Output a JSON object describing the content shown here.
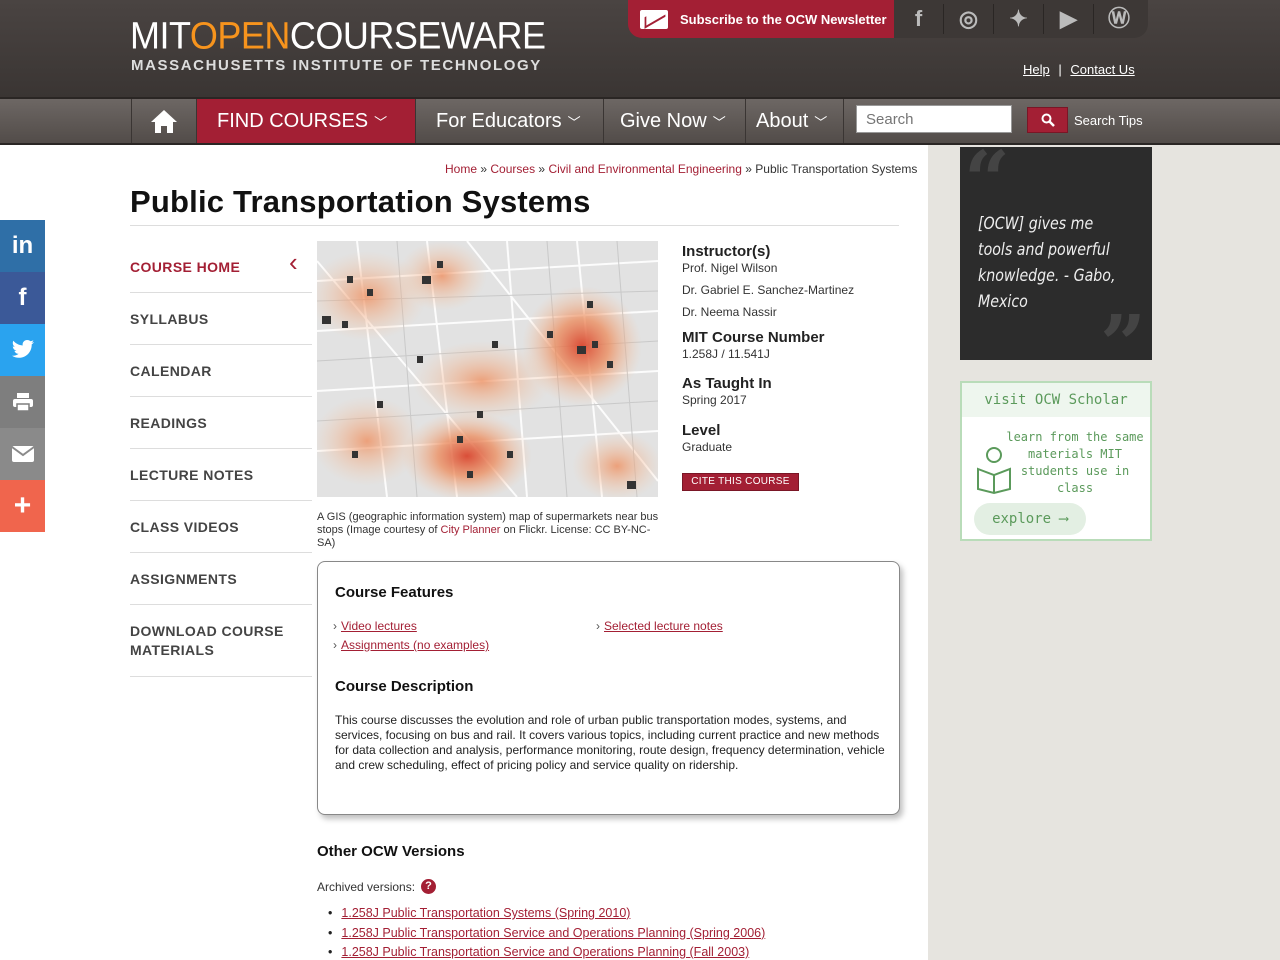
{
  "header": {
    "logo_mit": "MIT",
    "logo_open": "OPEN",
    "logo_courseware": "COURSEWARE",
    "logo_subtitle": "MASSACHUSETTS INSTITUTE OF TECHNOLOGY",
    "newsletter": "Subscribe to the OCW Newsletter",
    "social_icons": [
      "facebook-icon",
      "instagram-icon",
      "twitter-icon",
      "youtube-icon",
      "wordpress-icon"
    ],
    "help": "Help",
    "separator": "|",
    "contact": "Contact Us"
  },
  "nav": {
    "home_icon": "home-icon",
    "find_courses": "FIND COURSES",
    "for_educators": "For Educators",
    "give_now": "Give Now",
    "about": "About",
    "search_placeholder": "Search",
    "search_tips": "Search Tips"
  },
  "share": [
    "in",
    "f",
    "t",
    "print",
    "mail",
    "+"
  ],
  "breadcrumb": {
    "home": "Home",
    "courses": "Courses",
    "dept": "Civil and Environmental Engineering",
    "current": "Public Transportation Systems",
    "sep": "»"
  },
  "page_title": "Public Transportation Systems",
  "course_nav": [
    "COURSE HOME",
    "SYLLABUS",
    "CALENDAR",
    "READINGS",
    "LECTURE NOTES",
    "CLASS VIDEOS",
    "ASSIGNMENTS",
    "DOWNLOAD COURSE MATERIALS"
  ],
  "image_caption": {
    "before": "A GIS (geographic information system) map of supermarkets near bus stops (Image courtesy of ",
    "link": "City Planner",
    "after": " on Flickr. License: CC BY-NC-SA)"
  },
  "course_info": {
    "instructors_label": "Instructor(s)",
    "instructors": [
      "Prof. Nigel Wilson",
      "Dr. Gabriel E. Sanchez-Martinez",
      "Dr. Neema Nassir"
    ],
    "number_label": "MIT Course Number",
    "number": "1.258J / 11.541J",
    "taught_label": "As Taught In",
    "taught": "Spring 2017",
    "level_label": "Level",
    "level": "Graduate",
    "cite": "CITE THIS COURSE"
  },
  "features": {
    "heading": "Course Features",
    "items": [
      "Video lectures",
      "Selected lecture notes",
      "Assignments (no examples)"
    ]
  },
  "description": {
    "heading": "Course Description",
    "text": "This course discusses the evolution and role of urban public transportation modes, systems, and services, focusing on bus and rail. It covers various topics, including current practice and new methods for data collection and analysis, performance monitoring, route design, frequency determination, vehicle and crew scheduling, effect of pricing policy and service quality on ridership."
  },
  "other_versions": {
    "heading": "Other OCW Versions",
    "archived_label": "Archived versions:",
    "help_icon": "?",
    "items": [
      "1.258J Public Transportation Systems (Spring 2010)",
      "1.258J Public Transportation Service and Operations Planning (Spring 2006)",
      "1.258J Public Transportation Service and Operations Planning (Fall 2003)"
    ]
  },
  "sidebar": {
    "quote": "[OCW] gives me tools and powerful knowledge. - Gabo, Mexico",
    "scholar_title": "visit OCW Scholar",
    "scholar_text": "learn from the same materials MIT students use in class",
    "scholar_button": "explore ⟶"
  }
}
